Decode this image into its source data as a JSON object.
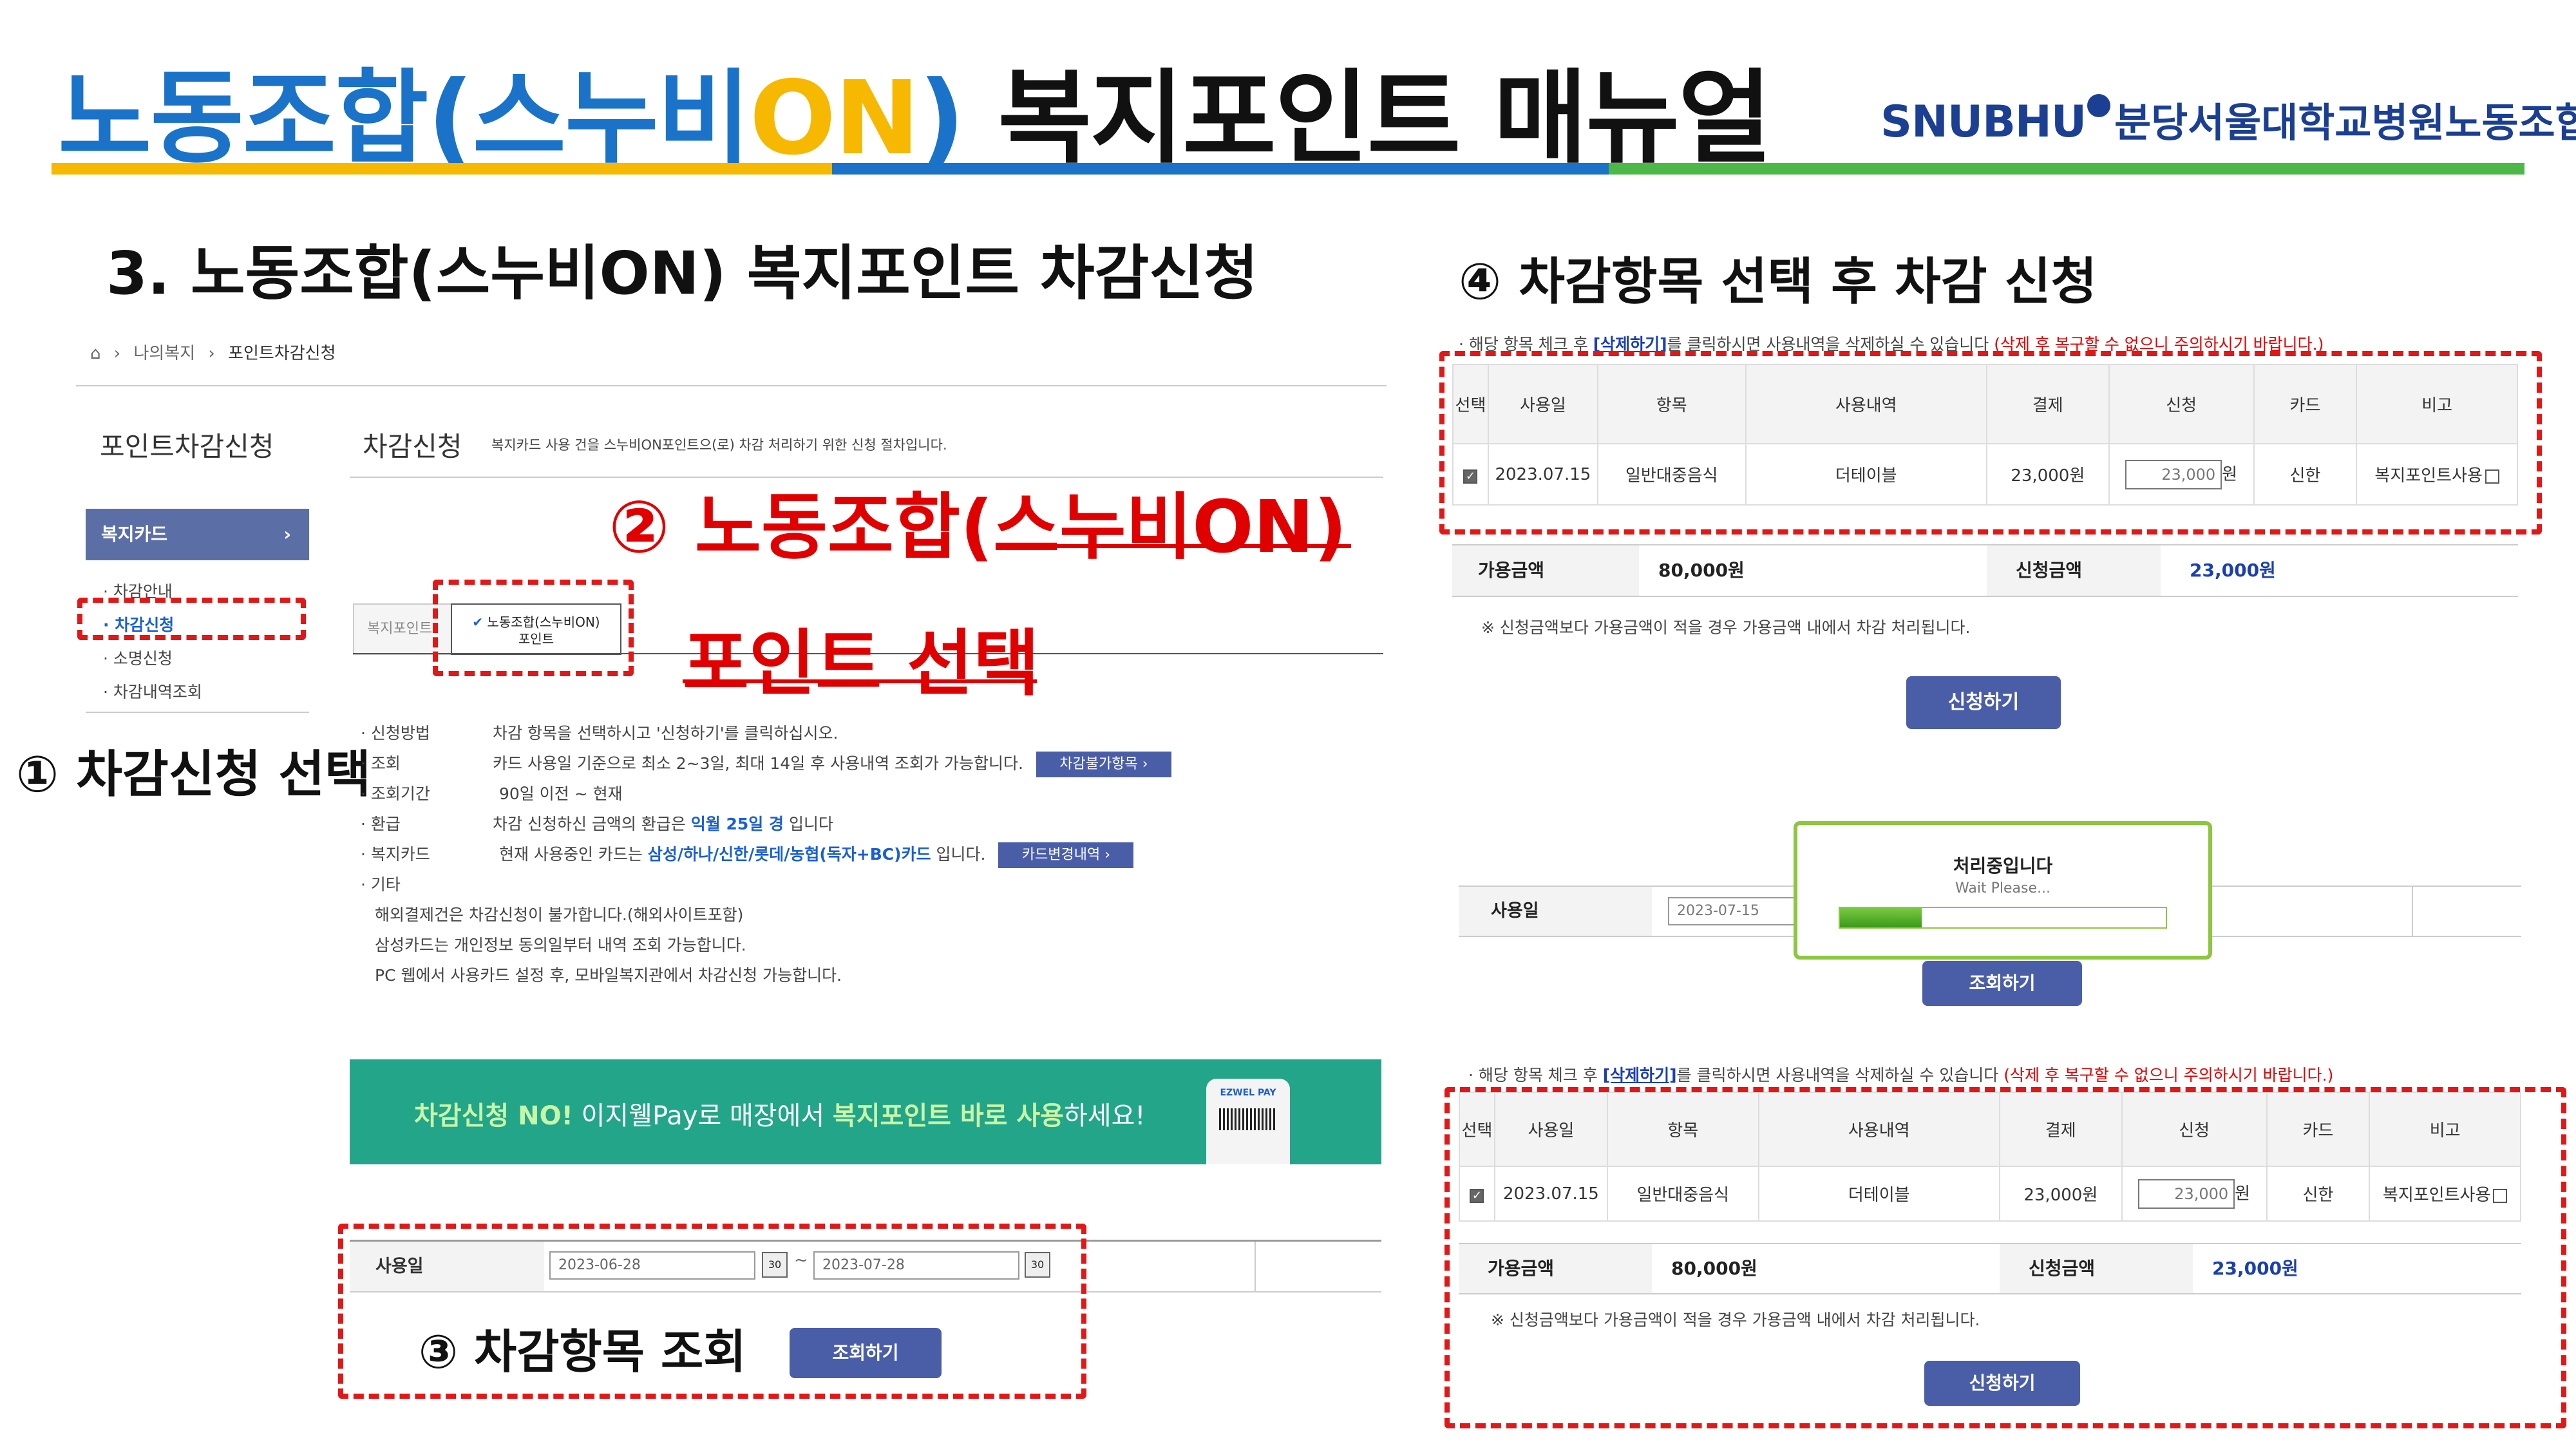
{
  "header": {
    "title_part1": "노동조합(스누비",
    "title_on": "ON",
    "title_part2": ")",
    "title_rest": "복지포인트 매뉴얼",
    "logo_en": "SNUBHU",
    "logo_kr": "분당서울대학교병원노동조합",
    "colors": {
      "blue": "#1a73c8",
      "yellow": "#f6b800",
      "green": "#4cb848"
    }
  },
  "section_title": "3. 노동조합(스누비ON) 복지포인트 차감신청",
  "step1": "① 차감신청 선택",
  "step2_line1": "② 노동조합(스누비ON)",
  "step2_line2": "포인트 선택",
  "step3": "③ 차감항목 조회",
  "step4": "④ 차감항목 선택 후 차감 신청",
  "left_panel": {
    "breadcrumb": [
      "나의복지",
      "포인트차감신청"
    ],
    "page_title": "포인트차감신청",
    "content_title": "차감신청",
    "content_desc": "복지카드 사용 건을 스누비ON포인트으(로) 차감 처리하기 위한 신청 절차입니다.",
    "sidebar_head": "복지카드",
    "sidebar_items": [
      "차감안내",
      "차감신청",
      "소명신청",
      "차감내역조회"
    ],
    "tab_inactive": "복지포인트",
    "tab_active_line1": "노동조합(스누비ON)",
    "tab_active_line2": "포인트",
    "info": [
      {
        "label": "신청방법",
        "text": "차감 항목을 선택하시고 '신청하기'를 클릭하십시오."
      },
      {
        "label": "조회",
        "text": "카드 사용일 기준으로 최소 2~3일, 최대 14일 후 사용내역 조회가 가능합니다.",
        "button": "차감불가항목"
      },
      {
        "label": "조회기간",
        "text": "90일 이전 ~ 현재"
      },
      {
        "label": "환급",
        "text_before": "차감 신청하신 금액의 환급은 ",
        "text_bold": "익월 25일 경",
        "text_after": " 입니다"
      },
      {
        "label": "복지카드",
        "text_before": "현재 사용중인 카드는 ",
        "text_bold": "삼성/하나/신한/롯데/농협(독자+BC)카드",
        "text_after": " 입니다.",
        "button": "카드변경내역"
      },
      {
        "label": "기타",
        "text": ""
      }
    ],
    "etc_lines": [
      "해외결제건은 차감신청이 불가합니다.(해외사이트포함)",
      "삼성카드는 개인정보 동의일부터 내역 조회 가능합니다.",
      "PC 웹에서 사용카드 설정 후, 모바일복지관에서 차감신청 가능합니다."
    ],
    "banner_text_1": "차감신청 NO!",
    "banner_text_2": " 이지웰Pay로 매장에서 ",
    "banner_text_3": "복지포인트 바로 사용",
    "banner_text_4": "하세요!",
    "banner_logo": "EZWEL PAY",
    "search_label": "사용일",
    "date_from": "2023-06-28",
    "date_to": "2023-07-28",
    "date_sep": "~",
    "search_button": "조회하기"
  },
  "right_panel": {
    "notice_before": "· 해당 항목 체크 후 ",
    "notice_link": "[삭제하기]",
    "notice_after": "를 클릭하시면 사용내역을 삭제하실 수 있습니다 ",
    "notice_red": "(삭제 후 복구할 수 없으니 주의하시기 바랍니다.)",
    "columns": [
      "선택",
      "사용일",
      "항목",
      "사용내역",
      "결제",
      "신청",
      "카드",
      "비고"
    ],
    "row": {
      "date": "2023.07.15",
      "category": "일반대중음식",
      "merchant": "더테이블",
      "payment": "23,000원",
      "request_value": "23,000",
      "request_unit": "원",
      "card": "신한",
      "note": "복지포인트사용"
    },
    "available_label": "가용금액",
    "available_value": "80,000원",
    "request_label": "신청금액",
    "request_value": "23,000원",
    "footnote": "※ 신청금액보다 가용금액이 적을 경우 가용금액 내에서 차감 처리됩니다.",
    "apply_button": "신청하기",
    "loading_title": "처리중입니다",
    "loading_sub": "Wait Please...",
    "loading_progress": 0.25,
    "search_label": "사용일",
    "search_date": "2023-07-15",
    "search_button": "조회하기"
  }
}
